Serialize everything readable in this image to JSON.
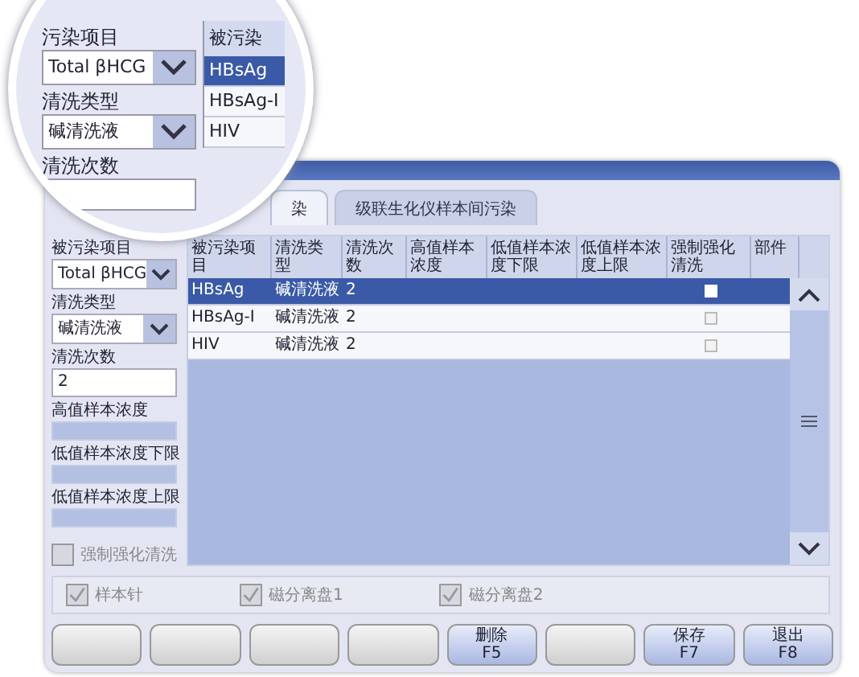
{
  "magnifier": {
    "project_label": "污染项目",
    "project_value": "Total βHCG",
    "wash_type_label": "清洗类型",
    "wash_type_value": "碱清洗液",
    "wash_count_label": "清洗次数",
    "table_header": "被污染",
    "rows": [
      {
        "name": "HBsAg",
        "selected": true
      },
      {
        "name": "HBsAg-I",
        "selected": false
      },
      {
        "name": "HIV",
        "selected": false
      }
    ]
  },
  "tabs": [
    {
      "label": "染",
      "selected": true
    },
    {
      "label": "级联生化仪样本间污染",
      "selected": false
    }
  ],
  "form": {
    "fields": [
      {
        "kind": "select",
        "label": "被污染项目",
        "value": "Total βHCG",
        "disabled": false
      },
      {
        "kind": "select",
        "label": "清洗类型",
        "value": "碱清洗液",
        "disabled": false
      },
      {
        "kind": "input",
        "label": "清洗次数",
        "value": "2",
        "disabled": false
      },
      {
        "kind": "input",
        "label": "高值样本浓度",
        "disabled": true
      },
      {
        "kind": "input",
        "label": "低值样本浓度下限",
        "disabled": true
      },
      {
        "kind": "input",
        "label": "低值样本浓度上限",
        "disabled": true
      }
    ],
    "force_clean": {
      "label": "强制强化清洗",
      "checked": false,
      "disabled": true
    }
  },
  "table": {
    "columns": [
      "被污染项目",
      "清洗类型",
      "清洗次数",
      "高值样本浓度",
      "低值样本浓度下限",
      "低值样本浓度上限",
      "强制强化清洗",
      "部件"
    ],
    "rows": [
      {
        "cells": [
          "HBsAg",
          "碱清洗液",
          "2"
        ],
        "forced": false,
        "selected": true
      },
      {
        "cells": [
          "HBsAg-I",
          "碱清洗液",
          "2"
        ],
        "forced": false,
        "selected": false
      },
      {
        "cells": [
          "HIV",
          "碱清洗液",
          "2"
        ],
        "forced": false,
        "selected": false
      }
    ]
  },
  "parts": [
    {
      "label": "样本针",
      "checked": true
    },
    {
      "label": "磁分离盘1",
      "checked": true
    },
    {
      "label": "磁分离盘2",
      "checked": true
    }
  ],
  "buttons": [
    {
      "kind": "blank"
    },
    {
      "kind": "blank"
    },
    {
      "kind": "blank"
    },
    {
      "kind": "blank"
    },
    {
      "kind": "command",
      "label": "删除",
      "key": "F5"
    },
    {
      "kind": "blank"
    },
    {
      "kind": "command",
      "label": "保存",
      "key": "F7"
    },
    {
      "kind": "command",
      "label": "退出",
      "key": "F8"
    }
  ]
}
